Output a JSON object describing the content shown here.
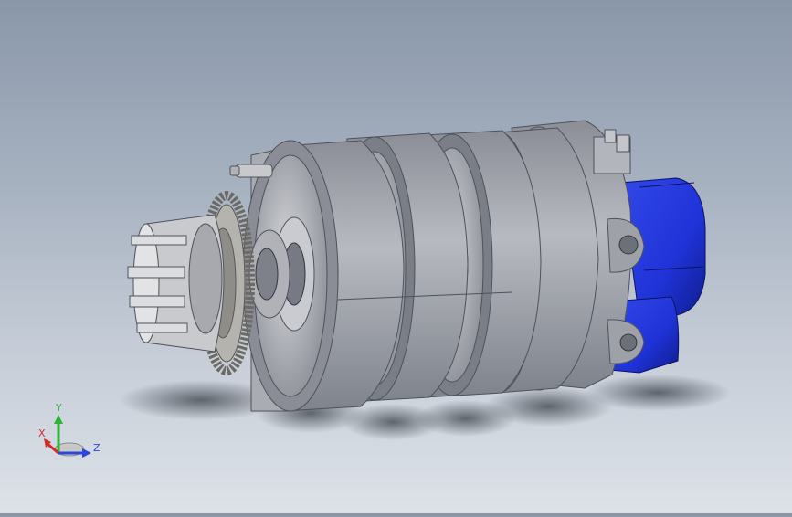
{
  "viewport": {
    "background_top": "#8a97a9",
    "background_bottom": "#dde2e8"
  },
  "model": {
    "part_colors": {
      "ring": "#a3a6ae",
      "ring_dark": "#6c7079",
      "motor": "#1f33d8",
      "motor_dark": "#0f1c8c",
      "gear": "#b5b3ad"
    }
  },
  "triad": {
    "x_label": "X",
    "y_label": "Y",
    "z_label": "Z",
    "x_color": "#d42a2a",
    "y_color": "#2fb43a",
    "z_color": "#2c48d8"
  }
}
